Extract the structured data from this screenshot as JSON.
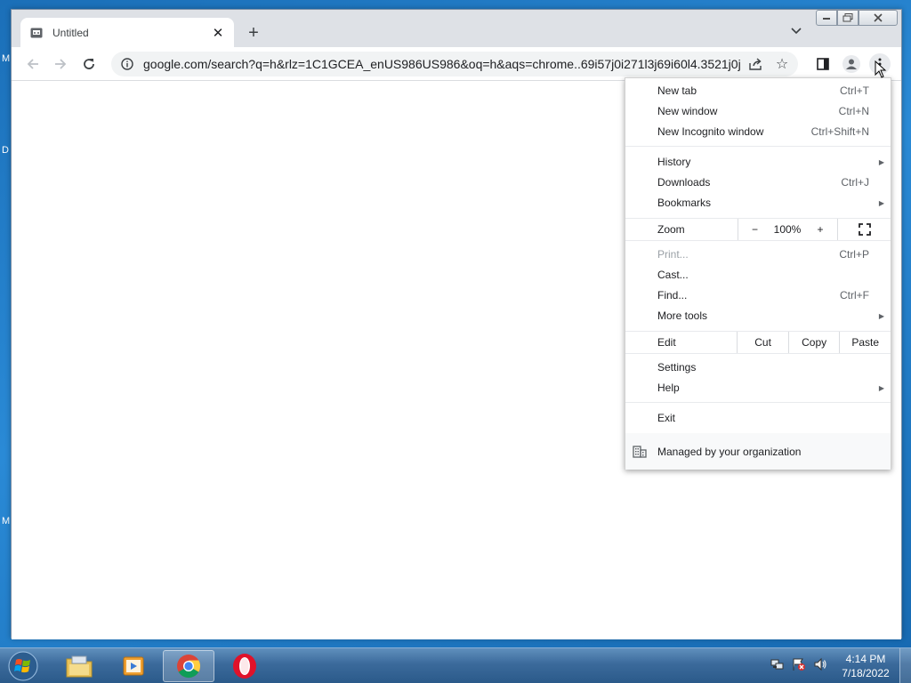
{
  "desktop": {
    "letters": [
      "M",
      "D",
      "M"
    ]
  },
  "browser": {
    "tab": {
      "title": "Untitled",
      "close": "✕"
    },
    "new_tab_symbol": "+",
    "url": "google.com/search?q=h&rlz=1C1GCEA_enUS986US986&oq=h&aqs=chrome..69i57j0i271l3j69i60l4.3521j0j..."
  },
  "menu": {
    "new_tab": {
      "label": "New tab",
      "shortcut": "Ctrl+T"
    },
    "new_window": {
      "label": "New window",
      "shortcut": "Ctrl+N"
    },
    "new_incognito": {
      "label": "New Incognito window",
      "shortcut": "Ctrl+Shift+N"
    },
    "history": {
      "label": "History"
    },
    "downloads": {
      "label": "Downloads",
      "shortcut": "Ctrl+J"
    },
    "bookmarks": {
      "label": "Bookmarks"
    },
    "zoom": {
      "label": "Zoom",
      "minus": "−",
      "level": "100%",
      "plus": "+"
    },
    "print": {
      "label": "Print...",
      "shortcut": "Ctrl+P"
    },
    "cast": {
      "label": "Cast..."
    },
    "find": {
      "label": "Find...",
      "shortcut": "Ctrl+F"
    },
    "more_tools": {
      "label": "More tools"
    },
    "edit": {
      "label": "Edit",
      "cut": "Cut",
      "copy": "Copy",
      "paste": "Paste"
    },
    "settings": {
      "label": "Settings"
    },
    "help": {
      "label": "Help"
    },
    "exit": {
      "label": "Exit"
    },
    "managed": {
      "label": "Managed by your organization"
    }
  },
  "taskbar": {
    "clock_time": "4:14 PM",
    "clock_date": "7/18/2022"
  },
  "colors": {
    "chrome_frame": "#dee1e6",
    "menu_bg": "#ffffff",
    "taskbar": "#3b6a9b",
    "desktop": "#1b6fb8",
    "opera_red": "#e0122a"
  }
}
